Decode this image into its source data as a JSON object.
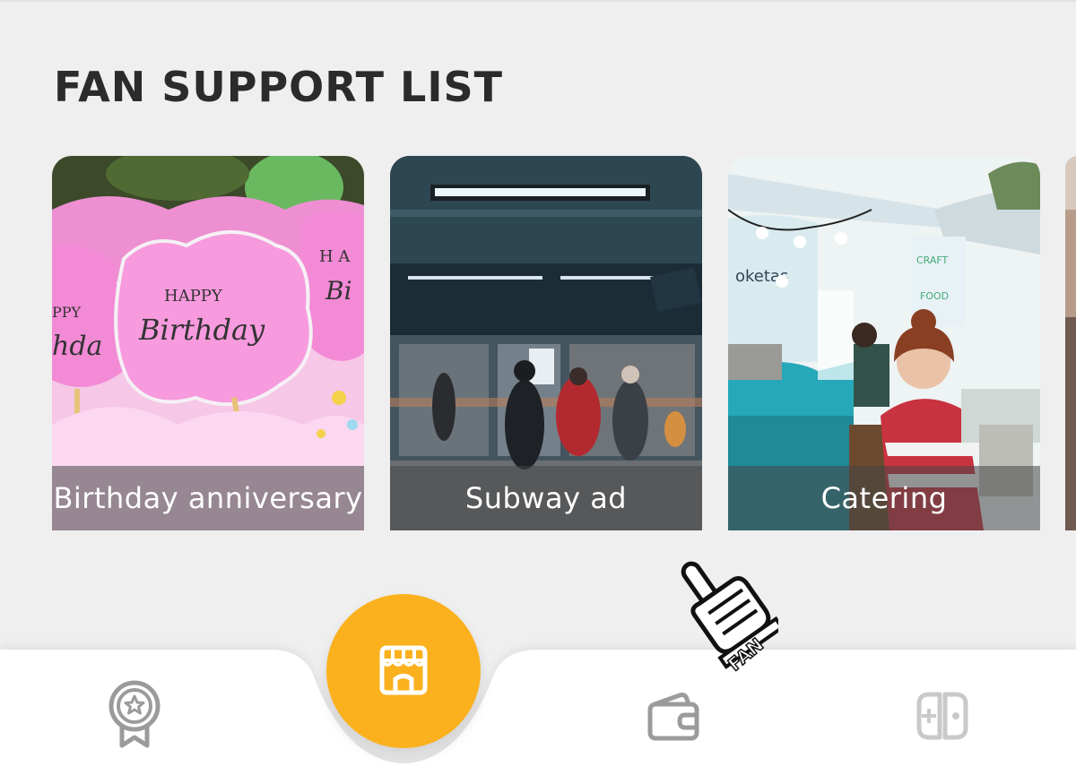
{
  "page": {
    "title": "FAN SUPPORT LIST"
  },
  "cards": [
    {
      "label": "Birthday anniversary",
      "photo": "birthday-cupcakes"
    },
    {
      "label": "Subway ad",
      "photo": "subway-station"
    },
    {
      "label": "Catering",
      "photo": "food-truck"
    },
    {
      "label": "",
      "photo": "partial-next-card"
    }
  ],
  "sticker": {
    "text": "FAN"
  },
  "nav": {
    "items": [
      {
        "icon": "badge-star-icon"
      },
      {
        "icon": "store-icon",
        "active": true
      },
      {
        "icon": "wallet-icon"
      },
      {
        "icon": "game-controller-icon"
      }
    ],
    "accent_color": "#fbb11d"
  }
}
